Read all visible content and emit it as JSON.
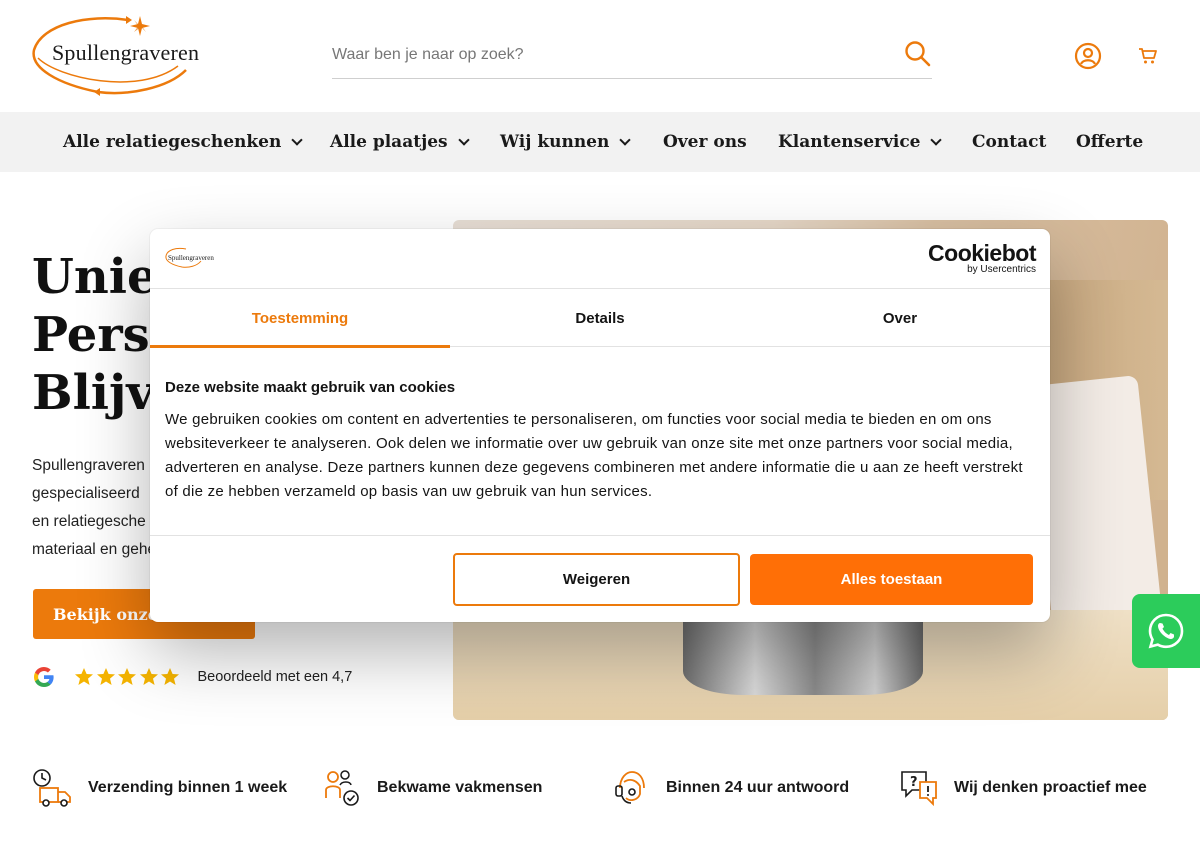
{
  "header": {
    "logo_text": "Spullengraveren",
    "search_placeholder": "Waar ben je naar op zoek?"
  },
  "nav": {
    "items": [
      {
        "label": "Alle relatiegeschenken",
        "dropdown": true
      },
      {
        "label": "Alle plaatjes",
        "dropdown": true
      },
      {
        "label": "Wij kunnen",
        "dropdown": true
      },
      {
        "label": "Over ons",
        "dropdown": false
      },
      {
        "label": "Klantenservice",
        "dropdown": true
      },
      {
        "label": "Contact",
        "dropdown": false
      },
      {
        "label": "Offerte",
        "dropdown": false
      }
    ]
  },
  "hero": {
    "title_lines": [
      "Uniek",
      "Persoonlijk",
      "Blijvend"
    ],
    "desc_lines": [
      "Spullengraveren",
      "gespecialiseerd",
      "en relatiegesche",
      "materiaal en gehe"
    ],
    "cta_label": "Bekijk onze",
    "rating_text": "Beoordeeld met een 4,7",
    "rating_value": 4.7,
    "stars": 5
  },
  "features": [
    {
      "label": "Verzending binnen 1 week",
      "icon": "delivery-truck-clock-icon"
    },
    {
      "label": "Bekwame vakmensen",
      "icon": "people-check-icon"
    },
    {
      "label": "Binnen 24 uur antwoord",
      "icon": "support-headset-icon"
    },
    {
      "label": "Wij denken proactief mee",
      "icon": "question-chat-icon"
    }
  ],
  "cookie": {
    "logo_text": "Spullengraveren",
    "brand": "Cookiebot",
    "brand_sub": "by Usercentrics",
    "tabs": [
      "Toestemming",
      "Details",
      "Over"
    ],
    "active_tab": "Toestemming",
    "heading": "Deze website maakt gebruik van cookies",
    "body": "We gebruiken cookies om content en advertenties te personaliseren, om functies voor social media te bieden en om ons websiteverkeer te analyseren. Ook delen we informatie over uw gebruik van onze site met onze partners voor social media, adverteren en analyse. Deze partners kunnen deze gegevens combineren met andere informatie die u aan ze heeft verstrekt of die ze hebben verzameld op basis van uw gebruik van hun services.",
    "decline_label": "Weigeren",
    "accept_label": "Alles toestaan"
  },
  "colors": {
    "accent": "#ec7a0c",
    "accept_button": "#ff6f06",
    "whatsapp": "#2ccc5b",
    "nav_bg": "#f2f2f2",
    "star": "#f5b400"
  }
}
